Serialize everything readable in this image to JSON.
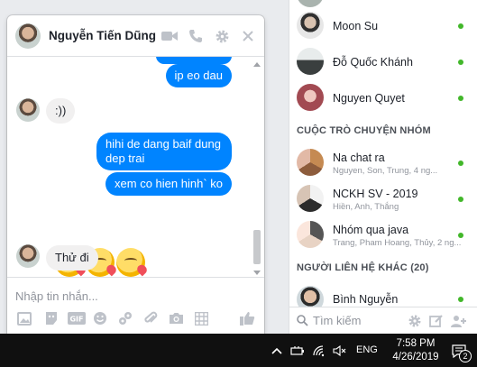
{
  "chat": {
    "contact_name": "Nguyễn Tiến Dũng",
    "messages": [
      {
        "from": "me",
        "text": "ip eo dau"
      },
      {
        "from": "them",
        "text": ":))"
      },
      {
        "from": "me",
        "text": "hihi de dang baif dung dep trai"
      },
      {
        "from": "me",
        "text": "xem co hien hinh` ko"
      },
      {
        "from": "them",
        "text": "Thử đi"
      }
    ],
    "emoji_count": 3,
    "composer_placeholder": "Nhập tin nhắn...",
    "accent_color": "#0084ff"
  },
  "sidebar": {
    "contacts_top": [
      {
        "name": "Moon Su",
        "online": true
      },
      {
        "name": "Đỗ Quốc Khánh",
        "online": true
      },
      {
        "name": "Nguyen Quyet",
        "online": true
      }
    ],
    "group_section_title": "CUỘC TRÒ CHUYỆN NHÓM",
    "groups": [
      {
        "name": "Na chat ra",
        "members": "Nguyen, Son, Trung, 4 ng...",
        "online": true
      },
      {
        "name": "NCKH SV - 2019",
        "members": "Hiền, Anh, Thắng",
        "online": true
      },
      {
        "name": "Nhóm qua java",
        "members": "Trang, Pham Hoang, Thủy, 2 ng...",
        "online": true
      }
    ],
    "other_section_title": "NGƯỜI LIÊN HỆ KHÁC (20)",
    "other_contacts": [
      {
        "name": "Bình Nguyễn",
        "online": true
      }
    ],
    "search_placeholder": "Tìm kiếm",
    "online_color": "#42b72a"
  },
  "taskbar": {
    "language": "ENG",
    "time": "7:58 PM",
    "date": "4/26/2019",
    "notification_count": "2"
  }
}
